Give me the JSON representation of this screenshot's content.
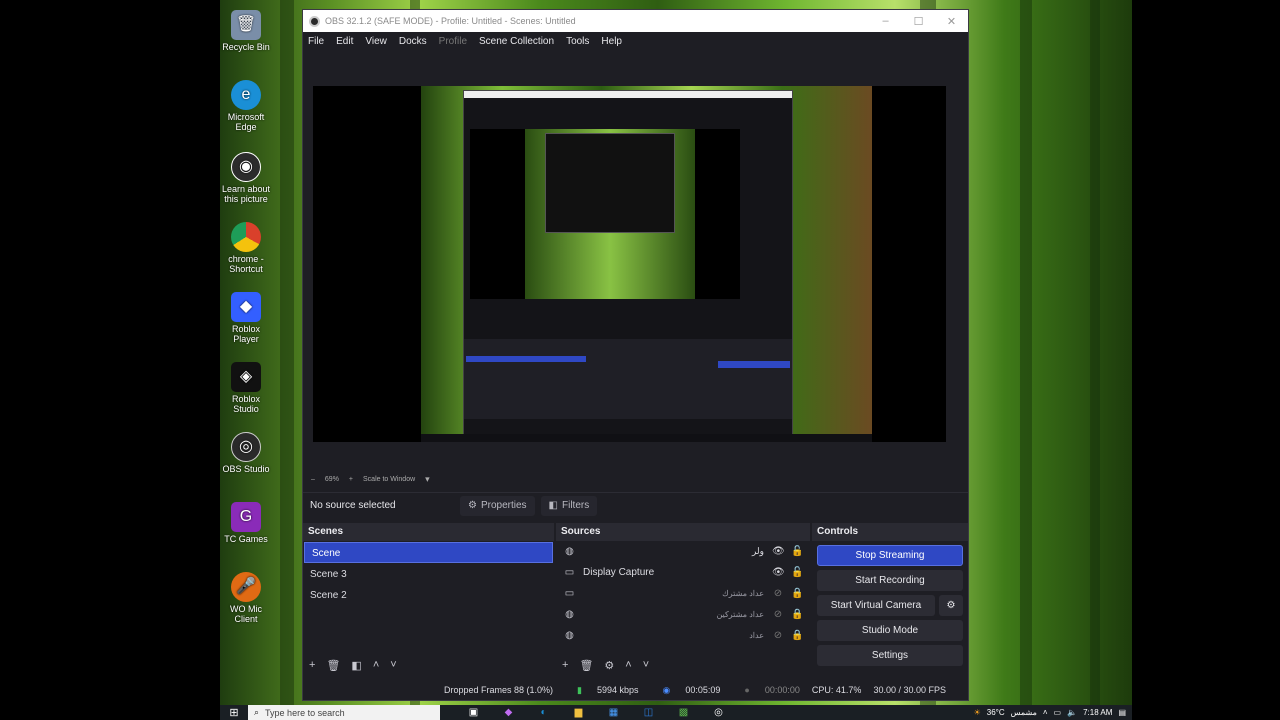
{
  "window": {
    "title": "OBS 32.1.2 (SAFE MODE) - Profile: Untitled - Scenes: Untitled",
    "minimize": "–",
    "maximize": "☐",
    "close": "✕"
  },
  "menu": [
    "File",
    "Edit",
    "View",
    "Docks",
    "Profile",
    "Scene Collection",
    "Tools",
    "Help"
  ],
  "zoom": {
    "minus": "–",
    "level": "69%",
    "plus": "+",
    "mode": "Scale to Window",
    "chevron": "▾"
  },
  "source_bar": {
    "label": "No source selected",
    "properties": "Properties",
    "filters": "Filters"
  },
  "scenes": {
    "header": "Scenes",
    "items": [
      {
        "label": "Scene",
        "active": true
      },
      {
        "label": "Scene 3",
        "active": false
      },
      {
        "label": "Scene 2",
        "active": false
      }
    ]
  },
  "sources": {
    "header": "Sources",
    "items": [
      {
        "label": "ولر",
        "icon": "globe-icon",
        "visible": true,
        "locked": false,
        "rtl": true
      },
      {
        "label": "Display Capture",
        "icon": "monitor-icon",
        "visible": true,
        "locked": false,
        "rtl": false
      },
      {
        "label": "عداد مشترك",
        "icon": "monitor-icon",
        "visible": false,
        "locked": true,
        "rtl": true
      },
      {
        "label": "عداد مشتركين",
        "icon": "globe-icon",
        "visible": false,
        "locked": true,
        "rtl": true
      },
      {
        "label": "عداد",
        "icon": "globe-icon",
        "visible": false,
        "locked": true,
        "rtl": true
      }
    ]
  },
  "controls": {
    "header": "Controls",
    "stop_streaming": "Stop Streaming",
    "start_recording": "Start Recording",
    "start_virtual_camera": "Start Virtual Camera",
    "studio_mode": "Studio Mode",
    "settings": "Settings"
  },
  "status": {
    "dropped_frames": "Dropped Frames 88 (1.0%)",
    "bitrate": "5994 kbps",
    "stream_time": "00:05:09",
    "record_time": "00:00:00",
    "cpu": "CPU: 41.7%",
    "fps": "30.00 / 30.00 FPS"
  },
  "desktop_icons": [
    {
      "label": "Recycle Bin",
      "icon": "recycle-bin-icon",
      "color": "#7a8ea8"
    },
    {
      "label": "Microsoft Edge",
      "icon": "edge-icon",
      "color": "#1a8fd6"
    },
    {
      "label": "Learn about this picture",
      "icon": "camera-icon",
      "color": "#2c2c2c"
    },
    {
      "label": "chrome - Shortcut",
      "icon": "chrome-icon",
      "color": "#d9402b"
    },
    {
      "label": "Roblox Player",
      "icon": "roblox-player-icon",
      "color": "#335fff"
    },
    {
      "label": "Roblox Studio",
      "icon": "roblox-studio-icon",
      "color": "#111111"
    },
    {
      "label": "OBS Studio",
      "icon": "obs-icon",
      "color": "#2a2a2a"
    },
    {
      "label": "TC Games",
      "icon": "tc-games-icon",
      "color": "#8a2bb8"
    },
    {
      "label": "WO Mic Client",
      "icon": "microphone-icon",
      "color": "#e06a14"
    }
  ],
  "taskbar": {
    "search_placeholder": "Type here to search",
    "weather": "36°C",
    "weather_label": "مشمس",
    "time": "7:18 AM"
  }
}
